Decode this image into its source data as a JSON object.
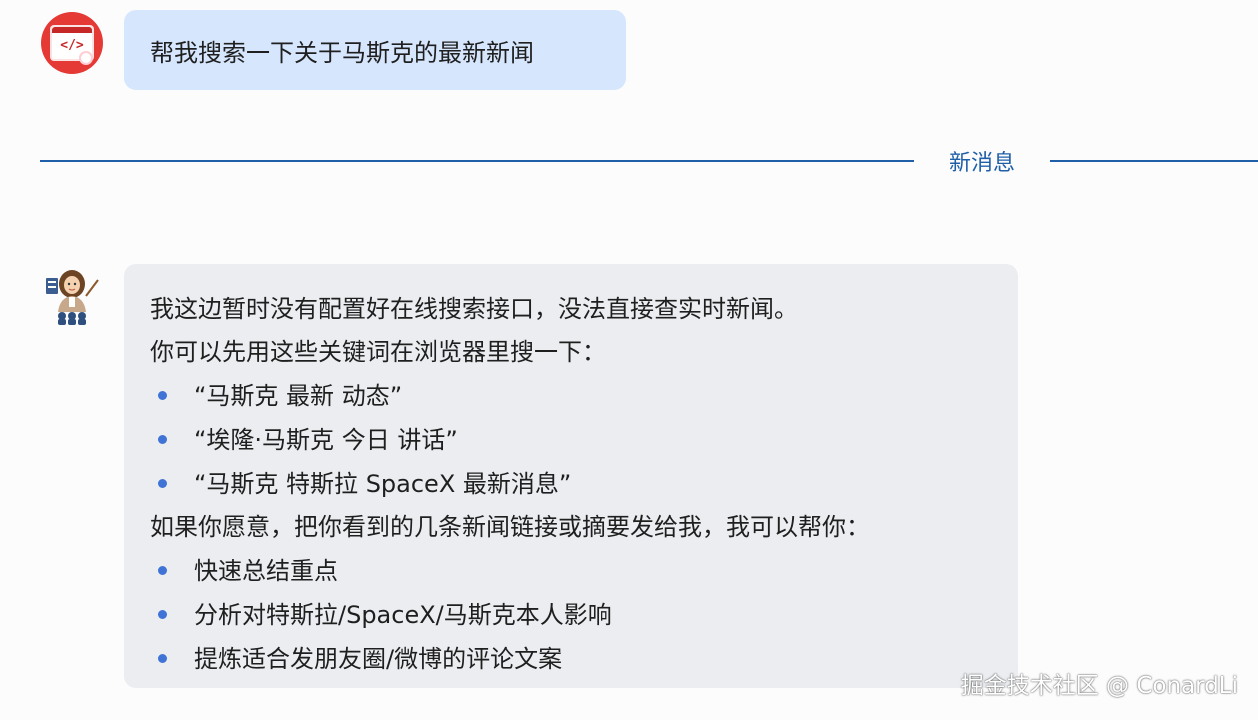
{
  "user_message": {
    "text": "帮我搜索一下关于马斯克的最新新闻"
  },
  "divider": {
    "label": "新消息"
  },
  "assistant_message": {
    "intro_1": "我这边暂时没有配置好在线搜索接口，没法直接查实时新闻。",
    "intro_2": "你可以先用这些关键词在浏览器里搜一下：",
    "keywords": [
      "“马斯克 最新 动态”",
      "“埃隆·马斯克 今日 讲话”",
      "“马斯克 特斯拉 SpaceX 最新消息”"
    ],
    "offer": "如果你愿意，把你看到的几条新闻链接或摘要发给我，我可以帮你：",
    "options": [
      "快速总结重点",
      "分析对特斯拉/SpaceX/马斯克本人影响",
      "提炼适合发朋友圈/微博的评论文案"
    ]
  },
  "watermark": "掘金技术社区 @ ConardLi",
  "colors": {
    "user_bubble": "#d6e6fd",
    "assistant_bubble": "#ebedf0",
    "divider": "#1f5fa8",
    "bullet": "#3f73d6",
    "user_avatar_bg": "#e53935"
  },
  "icons": {
    "user_avatar": "code-window-avatar-icon",
    "assistant_avatar": "teacher-avatar-icon"
  }
}
